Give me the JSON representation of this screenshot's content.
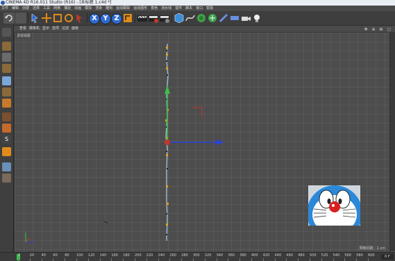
{
  "window": {
    "title": "CINEMA 4D R16.011 Studio (R16) - [未标题 1.c4d *]"
  },
  "menu": [
    "文件",
    "编辑",
    "创建",
    "选择",
    "工具",
    "网格",
    "捕捉",
    "动画",
    "模拟",
    "渲染",
    "雕刻",
    "运动跟踪",
    "运动图形",
    "角色",
    "流水线",
    "插件",
    "脚本",
    "窗口",
    "帮助"
  ],
  "toolbar": {
    "axis_x": "X",
    "axis_y": "Y",
    "axis_z": "Z"
  },
  "viewport": {
    "menu": [
      "查看",
      "摄像机",
      "显示",
      "选项",
      "过滤",
      "面板"
    ],
    "label": "透视视图",
    "grid_info": "网格间距：1 cm",
    "nav_icons": "✥ ⊕ ⊞ ▢"
  },
  "timeline": {
    "ticks": [
      "0",
      "20",
      "40",
      "60",
      "80",
      "100",
      "120",
      "140",
      "160",
      "180",
      "200",
      "220",
      "240",
      "260",
      "280",
      "300",
      "320",
      "340",
      "360",
      "380",
      "400",
      "420",
      "440",
      "460",
      "480",
      "500",
      "520",
      "540",
      "560",
      "580",
      "600"
    ],
    "frame": "0 F",
    "current_frame": 0
  },
  "colors": {
    "axis_y": "#3ec04a",
    "axis_x": "#2a43d6",
    "axis_z": "#c0392b",
    "spline": "#9fb7c9",
    "selected_point": "#e0a020"
  }
}
